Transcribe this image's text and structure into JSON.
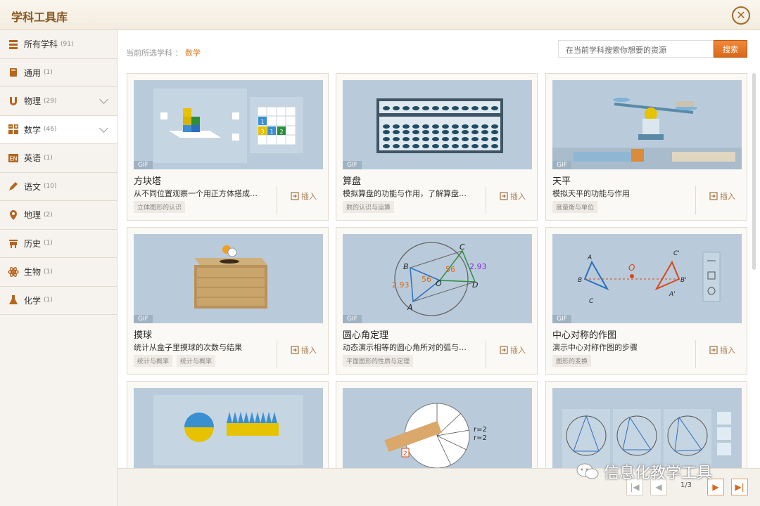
{
  "window": {
    "title": "学科工具库",
    "close_label": "✕"
  },
  "sidebar": {
    "items": [
      {
        "label": "所有学科",
        "count": "(91)",
        "icon": "stack-icon"
      },
      {
        "label": "通用",
        "count": "(1)",
        "icon": "book-icon"
      },
      {
        "label": "物理",
        "count": "(29)",
        "icon": "magnet-icon"
      },
      {
        "label": "数学",
        "count": "(46)",
        "icon": "math-icon"
      },
      {
        "label": "英语",
        "count": "(1)",
        "icon": "en-icon"
      },
      {
        "label": "语文",
        "count": "(10)",
        "icon": "pen-icon"
      },
      {
        "label": "地理",
        "count": "(2)",
        "icon": "map-pin-icon"
      },
      {
        "label": "历史",
        "count": "(1)",
        "icon": "ding-icon"
      },
      {
        "label": "生物",
        "count": "(1)",
        "icon": "atom-icon"
      },
      {
        "label": "化学",
        "count": "(1)",
        "icon": "flask-icon"
      }
    ]
  },
  "header": {
    "crumb_label": "当前所选学科 ：",
    "crumb_value": "数学",
    "search_placeholder": "在当前学科搜索你想要的资源",
    "search_button": "搜索"
  },
  "cards": [
    {
      "badge": "GIF",
      "title": "方块塔",
      "desc": "从不同位置观察一个用正方体搭成…",
      "tags": [
        "立体图形的认识"
      ],
      "insert": "插入"
    },
    {
      "badge": "GIF",
      "title": "算盘",
      "desc": "模拟算盘的功能与作用，了解算盘…",
      "tags": [
        "数的认识与运算"
      ],
      "insert": "插入"
    },
    {
      "badge": "GIF",
      "title": "天平",
      "desc": "模拟天平的功能与作用",
      "tags": [
        "度量衡与单位"
      ],
      "insert": "插入"
    },
    {
      "badge": "GIF",
      "title": "摸球",
      "desc": "统计从盒子里摸球的次数与结果",
      "tags": [
        "统计与概率",
        "统计与概率"
      ],
      "insert": "插入"
    },
    {
      "badge": "GIF",
      "title": "圆心角定理",
      "desc": "动态演示相等的圆心角所对的弧与…",
      "tags": [
        "平面图形的性质与定理"
      ],
      "insert": "插入"
    },
    {
      "badge": "GIF",
      "title": "中心对称的作图",
      "desc": "演示中心对称作图的步骤",
      "tags": [
        "图形的变换"
      ],
      "insert": "插入"
    }
  ],
  "pager": {
    "page": "1/3",
    "first": "|◀",
    "prev": "◀",
    "next": "▶",
    "last": "▶|"
  },
  "watermark": "信息化教学工具",
  "colors": {
    "accent": "#e07a1f",
    "title": "#8a5a22",
    "thumb": "#b9cbda"
  }
}
